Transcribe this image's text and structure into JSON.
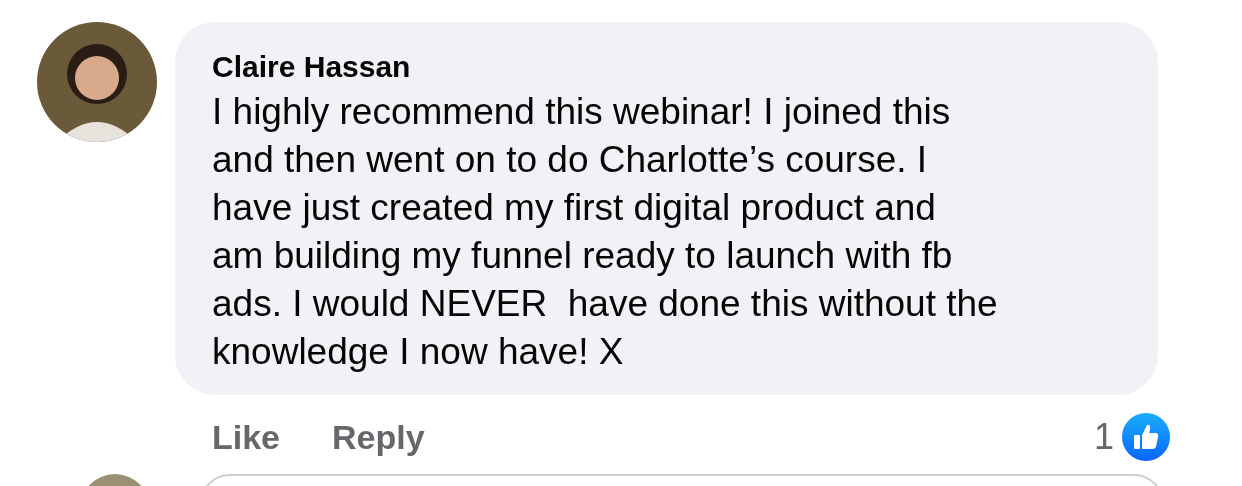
{
  "comment": {
    "author": "Claire Hassan",
    "text": "I highly recommend this webinar! I joined this\nand then went on to do Charlotte’s course. I\nhave just created my first digital product and\nam building my funnel ready to launch with fb\nads. I would NEVER  have done this without the\nknowledge I now have! X",
    "actions": [
      {
        "label": "Like"
      },
      {
        "label": "Reply"
      }
    ],
    "reaction_count": "1"
  }
}
